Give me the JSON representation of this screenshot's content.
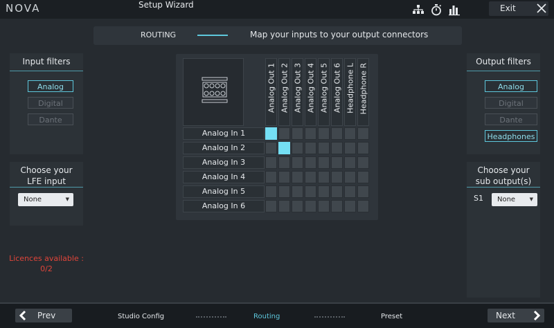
{
  "app": {
    "logo": "NOVA",
    "wizard_title": "Setup Wizard",
    "exit_label": "Exit"
  },
  "banner": {
    "step": "ROUTING",
    "description": "Map your inputs to your output connectors"
  },
  "input_filters": {
    "title": "Input filters",
    "buttons": [
      {
        "label": "Analog",
        "active": true
      },
      {
        "label": "Digital",
        "active": false
      },
      {
        "label": "Dante",
        "active": false
      }
    ]
  },
  "lfe": {
    "title": "Choose your LFE input",
    "selected": "None"
  },
  "licences": {
    "text": "Licences available : 0/2"
  },
  "output_filters": {
    "title": "Output filters",
    "buttons": [
      {
        "label": "Analog",
        "active": true
      },
      {
        "label": "Digital",
        "active": false
      },
      {
        "label": "Dante",
        "active": false
      },
      {
        "label": "Headphones",
        "active": true
      }
    ]
  },
  "sub_output": {
    "title": "Choose your sub output(s)",
    "row_label": "S1",
    "selected": "None"
  },
  "matrix": {
    "outputs": [
      "Analog Out 1",
      "Analog Out 2",
      "Analog Out 3",
      "Analog Out 4",
      "Analog Out 5",
      "Analog Out 6",
      "Headphone L",
      "Headphone R"
    ],
    "inputs": [
      "Analog In 1",
      "Analog In 2",
      "Analog In 3",
      "Analog In 4",
      "Analog In 5",
      "Analog In 6"
    ],
    "routes": [
      [
        0,
        0
      ],
      [
        1,
        1
      ]
    ]
  },
  "footer": {
    "prev_label": "Prev",
    "next_label": "Next",
    "steps": [
      {
        "label": "Studio Config",
        "active": false
      },
      {
        "label": "Routing",
        "active": true
      },
      {
        "label": "Preset",
        "active": false
      }
    ]
  },
  "colors": {
    "accent": "#5ec8dd",
    "route_on": "#74dff4",
    "warning": "#e0453a"
  }
}
